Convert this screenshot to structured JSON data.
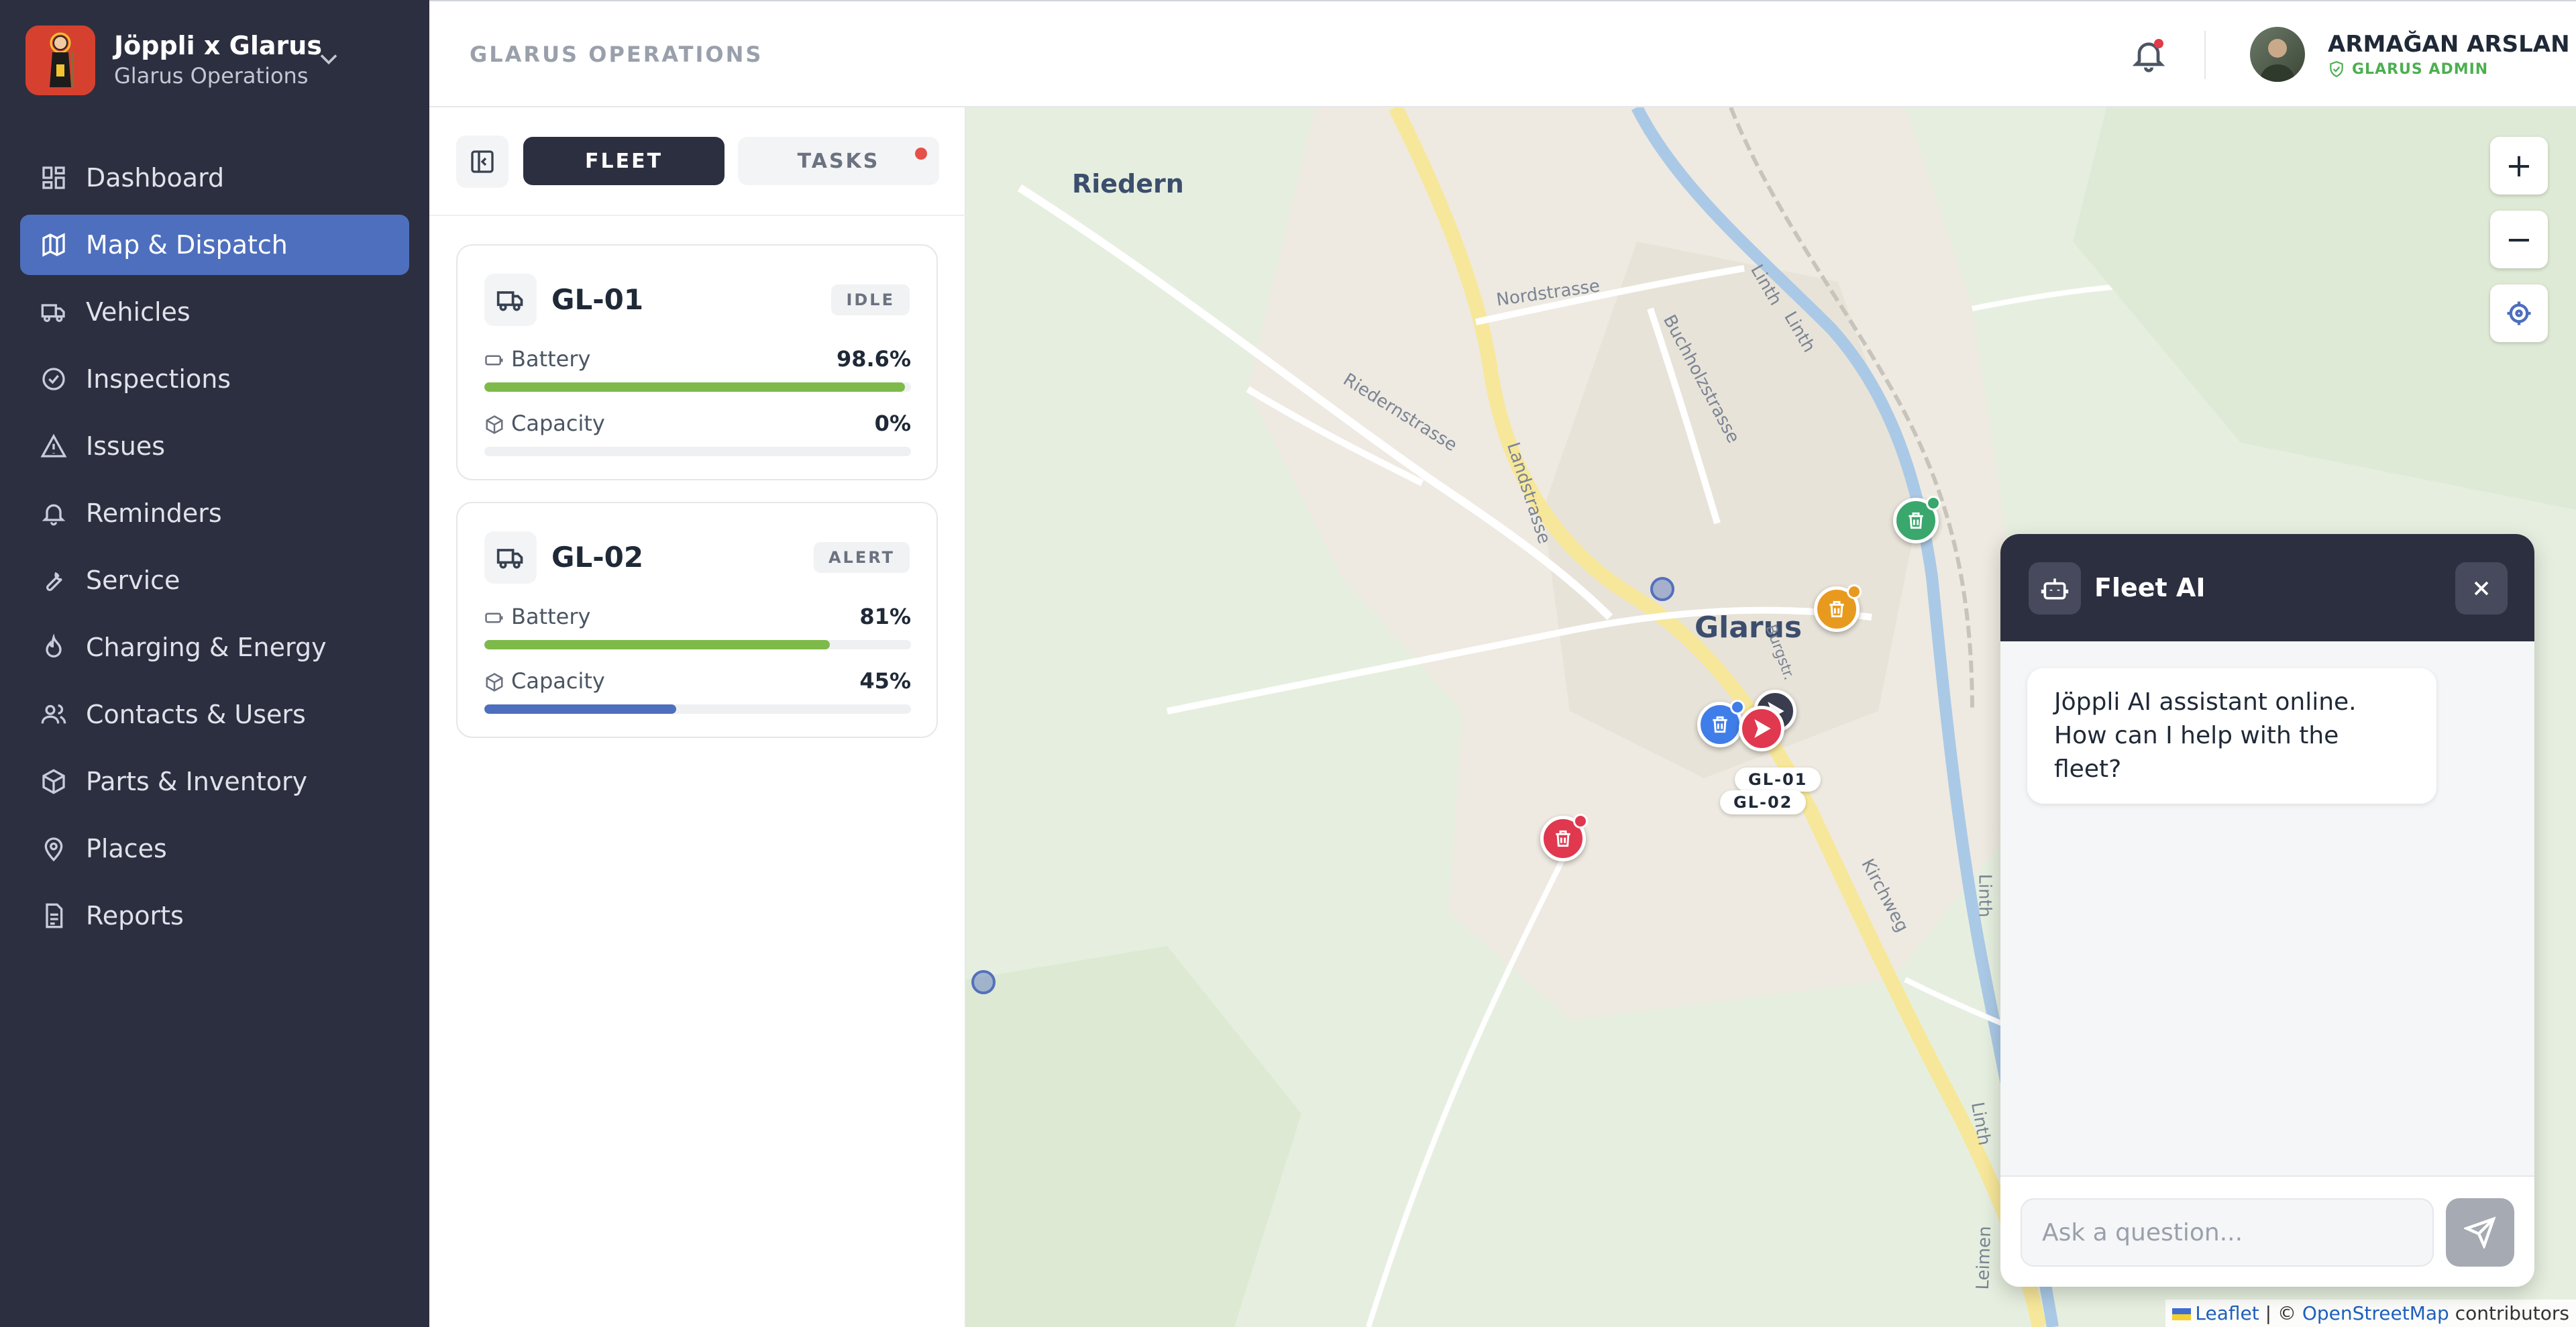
{
  "brand": {
    "title": "Jöppli x Glarus",
    "subtitle": "Glarus Operations"
  },
  "nav": {
    "items": [
      {
        "label": "Dashboard",
        "icon": "dashboard-icon"
      },
      {
        "label": "Map & Dispatch",
        "icon": "map-icon",
        "active": true
      },
      {
        "label": "Vehicles",
        "icon": "truck-icon"
      },
      {
        "label": "Inspections",
        "icon": "check-circle-icon"
      },
      {
        "label": "Issues",
        "icon": "alert-triangle-icon"
      },
      {
        "label": "Reminders",
        "icon": "bell-icon"
      },
      {
        "label": "Service",
        "icon": "wrench-icon"
      },
      {
        "label": "Charging & Energy",
        "icon": "flame-icon"
      },
      {
        "label": "Contacts & Users",
        "icon": "users-icon"
      },
      {
        "label": "Parts & Inventory",
        "icon": "box-icon"
      },
      {
        "label": "Places",
        "icon": "pin-icon"
      },
      {
        "label": "Reports",
        "icon": "report-icon"
      }
    ]
  },
  "header": {
    "org_title": "GLARUS OPERATIONS",
    "user_name": "ARMAĞAN ARSLAN",
    "user_role": "GLARUS ADMIN"
  },
  "panel": {
    "tabs": {
      "fleet": "FLEET",
      "tasks": "TASKS"
    },
    "vehicles": [
      {
        "id": "GL-01",
        "status": "IDLE",
        "battery_label": "Battery",
        "battery": "98.6%",
        "battery_pct": 98.6,
        "capacity_label": "Capacity",
        "capacity": "0%",
        "capacity_pct": 0
      },
      {
        "id": "GL-02",
        "status": "ALERT",
        "battery_label": "Battery",
        "battery": "81%",
        "battery_pct": 81,
        "capacity_label": "Capacity",
        "capacity": "45%",
        "capacity_pct": 45
      }
    ]
  },
  "map": {
    "places": {
      "riedern": "Riedern",
      "glarus": "Glarus"
    },
    "streets": {
      "nordstrasse": "Nordstrasse",
      "buchholzstrasse": "Buchholzstrasse",
      "riedernstrasse": "Riedernstrasse",
      "landstrasse": "Landstrasse",
      "linth1": "Linth",
      "linth2": "Linth",
      "linth3": "Linth",
      "linth4": "Linth",
      "kirchweg": "Kirchweg",
      "burgstrasse": "Burgstr.",
      "leimen": "Leimen"
    },
    "vehicle_labels": {
      "gl01": "GL-01",
      "gl02": "GL-02"
    },
    "zoom_in": "+",
    "zoom_out": "−",
    "attribution": {
      "leaflet": "Leaflet",
      "sep": " | © ",
      "osm": "OpenStreetMap",
      "contrib": " contributors"
    },
    "colors": {
      "green": "#3aa76d",
      "orange": "#e89a1f",
      "red": "#e0384f",
      "blue": "#3f7ee8",
      "dark": "#3a3d4d"
    }
  },
  "chat": {
    "title": "Fleet AI",
    "message": "Jöppli AI assistant online. How can I help with the fleet?",
    "placeholder": "Ask a question..."
  }
}
